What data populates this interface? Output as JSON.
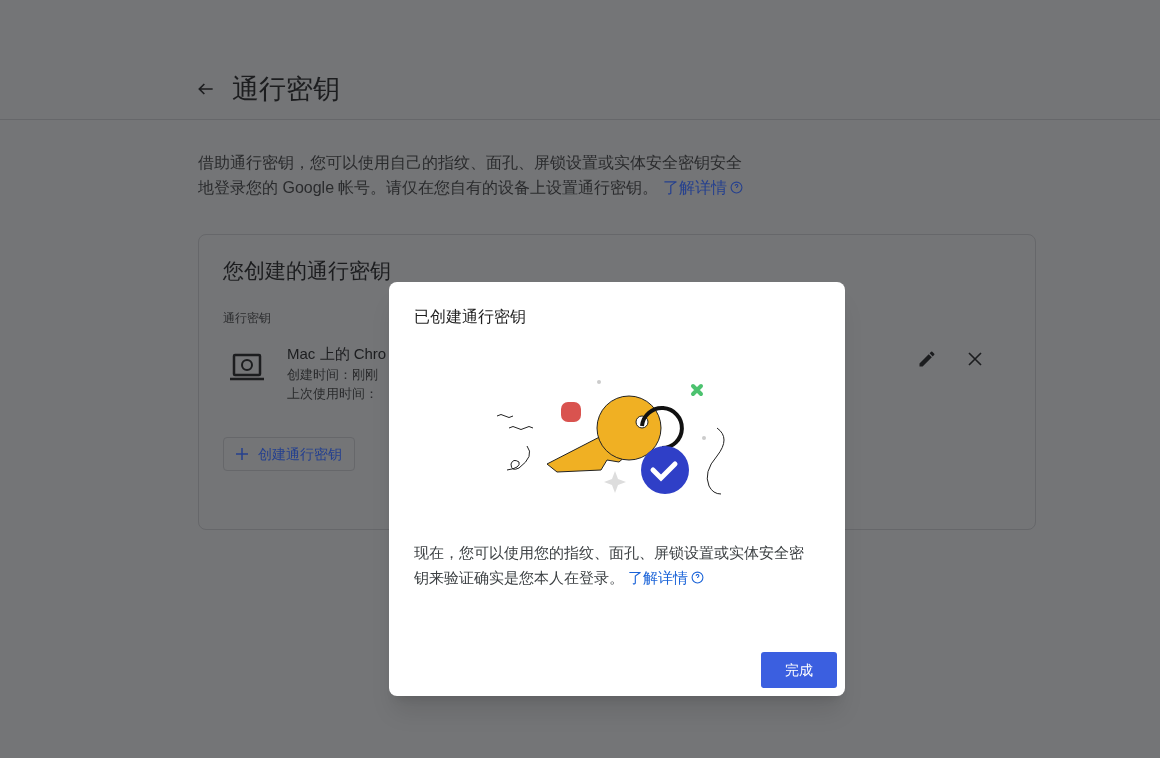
{
  "page": {
    "title": "通行密钥",
    "description": "借助通行密钥，您可以使用自己的指纹、面孔、屏锁设置或实体安全密钥安全地登录您的 Google 帐号。请仅在您自有的设备上设置通行密钥。",
    "learn_more": "了解详情"
  },
  "card": {
    "title": "您创建的通行密钥",
    "section_label": "通行密钥",
    "passkeys": [
      {
        "name": "Mac 上的 Chro",
        "created": "创建时间：刚刚",
        "last_used": "上次使用时间："
      }
    ],
    "create_button": "创建通行密钥"
  },
  "dialog": {
    "title": "已创建通行密钥",
    "body": "现在，您可以使用您的指纹、面孔、屏锁设置或实体安全密钥来验证确实是您本人在登录。",
    "learn_more": "了解详情",
    "done_button": "完成"
  }
}
